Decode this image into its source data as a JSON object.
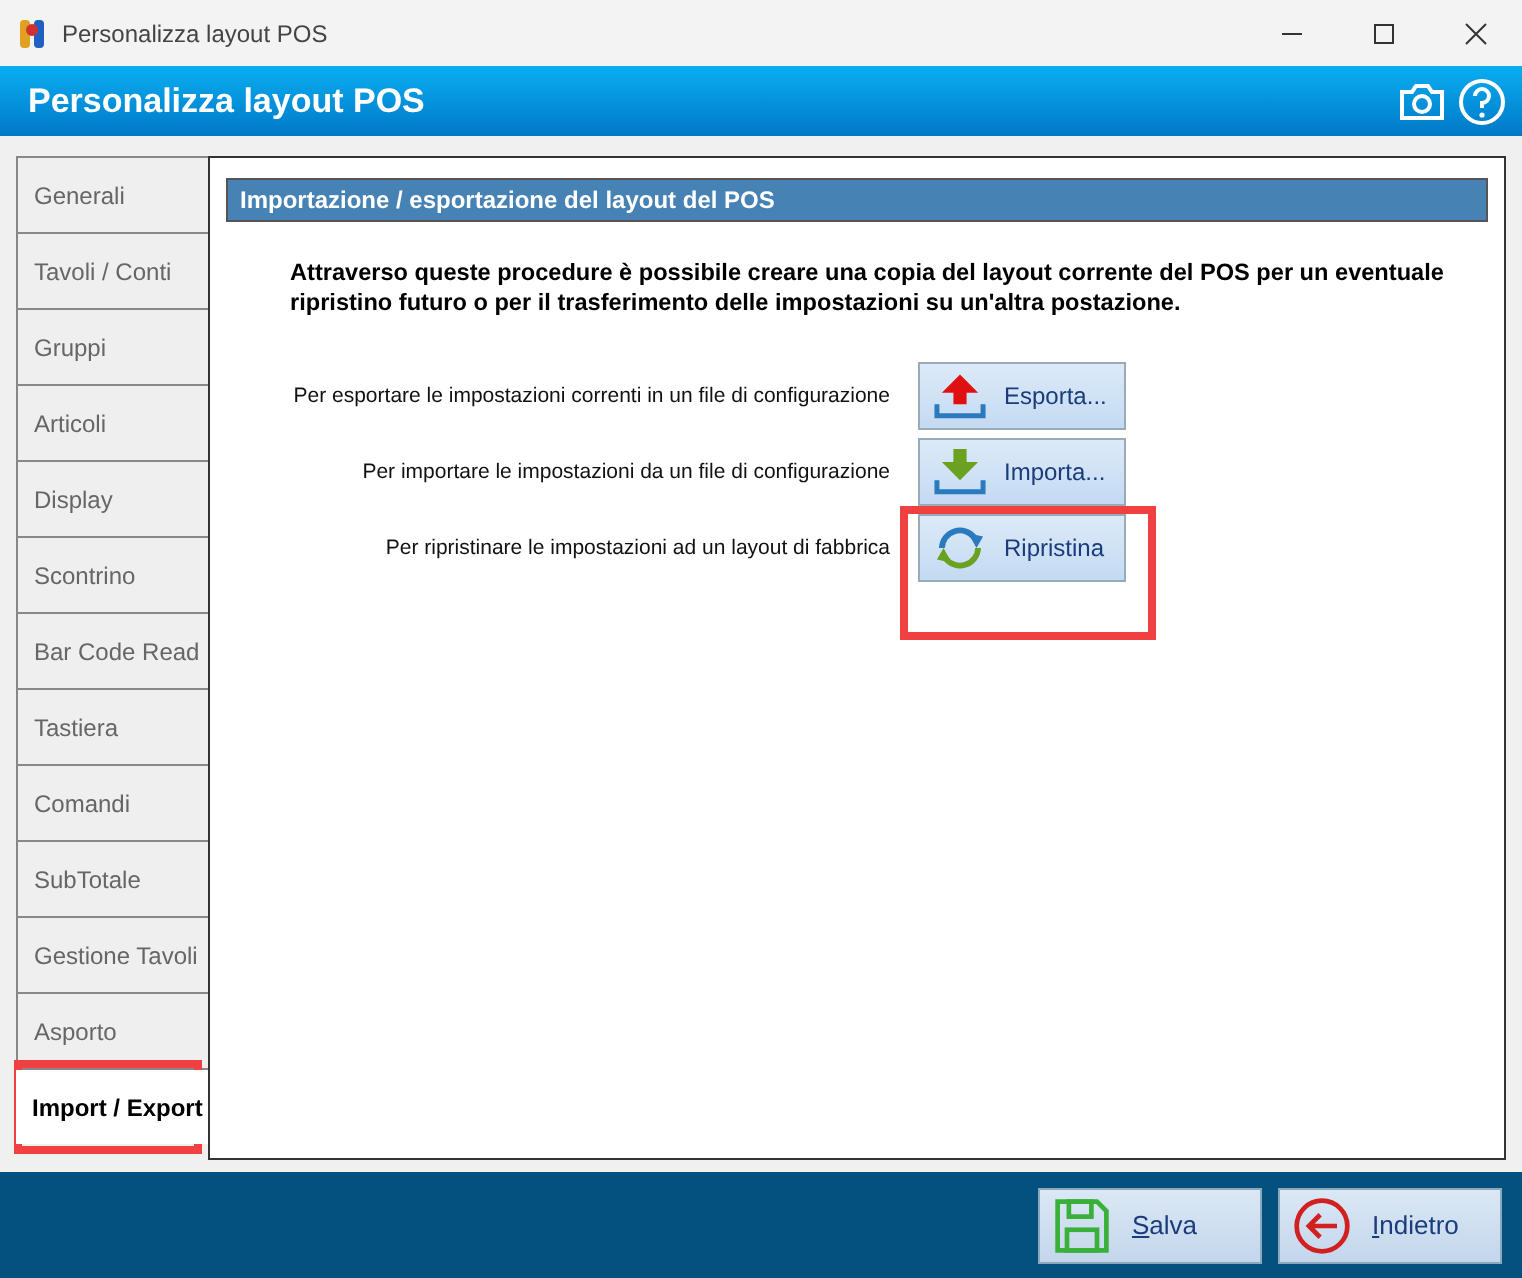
{
  "window": {
    "title": "Personalizza layout POS"
  },
  "header": {
    "title": "Personalizza layout POS"
  },
  "tabs": [
    {
      "label": "Generali",
      "selected": false
    },
    {
      "label": "Tavoli / Conti",
      "selected": false
    },
    {
      "label": "Gruppi",
      "selected": false
    },
    {
      "label": "Articoli",
      "selected": false
    },
    {
      "label": "Display",
      "selected": false
    },
    {
      "label": "Scontrino",
      "selected": false
    },
    {
      "label": "Bar Code Read",
      "selected": false
    },
    {
      "label": "Tastiera",
      "selected": false
    },
    {
      "label": "Comandi",
      "selected": false
    },
    {
      "label": "SubTotale",
      "selected": false
    },
    {
      "label": "Gestione Tavoli",
      "selected": false
    },
    {
      "label": "Asporto",
      "selected": false
    },
    {
      "label": "Import / Export",
      "selected": true
    }
  ],
  "panel": {
    "section_title": "Importazione / esportazione del layout del POS",
    "intro": "Attraverso queste procedure è possibile creare una copia del layout corrente del POS per un eventuale ripristino futuro o per il trasferimento delle impostazioni su un'altra postazione.",
    "actions": [
      {
        "kind": "export",
        "description": "Per esportare le impostazioni correnti in un file di configurazione",
        "button": "Esporta..."
      },
      {
        "kind": "import",
        "description": "Per importare le impostazioni da un file di configurazione",
        "button": "Importa..."
      },
      {
        "kind": "restore",
        "description": "Per ripristinare le impostazioni ad un layout di fabbrica",
        "button": "Ripristina"
      }
    ]
  },
  "footer": {
    "buttons": [
      {
        "kind": "save",
        "label": "Salva"
      },
      {
        "kind": "back",
        "label": "Indietro"
      }
    ]
  }
}
